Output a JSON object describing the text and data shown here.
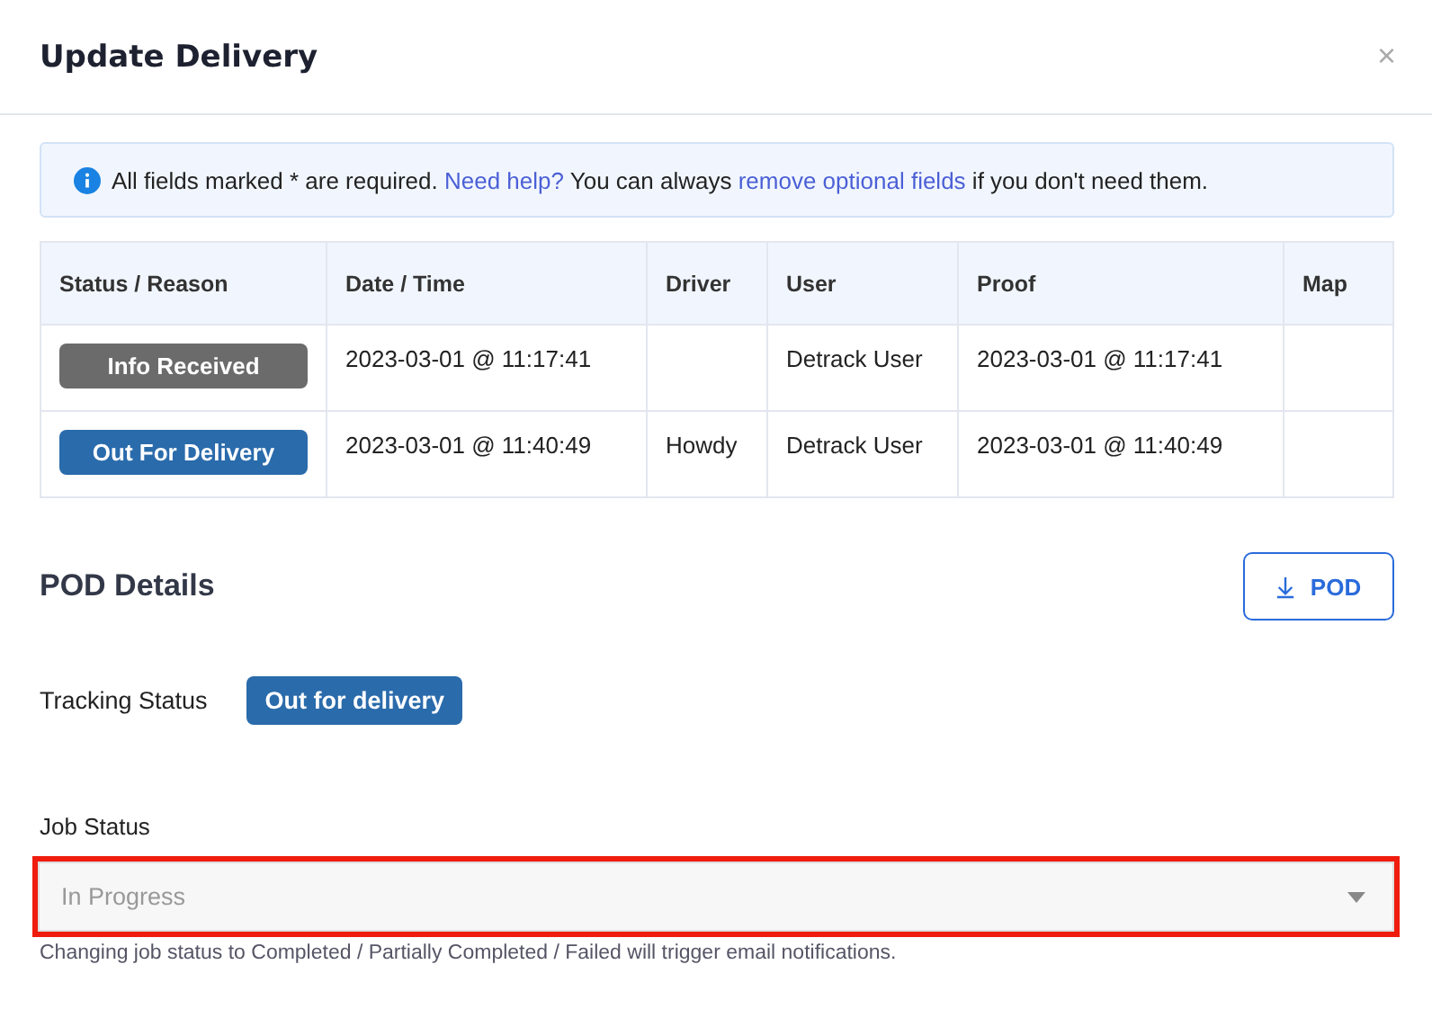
{
  "dialog": {
    "title": "Update Delivery",
    "close": "×"
  },
  "notice": {
    "parts": [
      {
        "kind": "text",
        "text": "All fields marked * are required. "
      },
      {
        "kind": "link",
        "text": "Need help?"
      },
      {
        "kind": "text",
        "text": " You can always "
      },
      {
        "kind": "link",
        "text": "remove optional fields"
      },
      {
        "kind": "text",
        "text": " if you don't need them."
      }
    ]
  },
  "table": {
    "columns": [
      "Status / Reason",
      "Date / Time",
      "Driver",
      "User",
      "Proof",
      "Map"
    ],
    "rows": [
      {
        "color": "#6b6b6b",
        "cells": [
          "Info Received",
          "2023-03-01 @ 11:17:41",
          "",
          "Detrack User",
          "2023-03-01 @ 11:17:41",
          ""
        ]
      },
      {
        "color": "#2a6bab",
        "cells": [
          "Out For Delivery",
          "2023-03-01 @ 11:40:49",
          "Howdy",
          "Detrack User",
          "2023-03-01 @ 11:40:49",
          ""
        ]
      }
    ]
  },
  "pod": {
    "title": "POD Details",
    "download_button": "POD"
  },
  "tracking_status": {
    "label": "Tracking Status",
    "value": "Out for delivery"
  },
  "job_status": {
    "label": "Job Status",
    "value": "In Progress",
    "disabled": true,
    "highlighted": true,
    "help": "Changing job status to Completed / Partially Completed / Failed will trigger email notifications."
  }
}
